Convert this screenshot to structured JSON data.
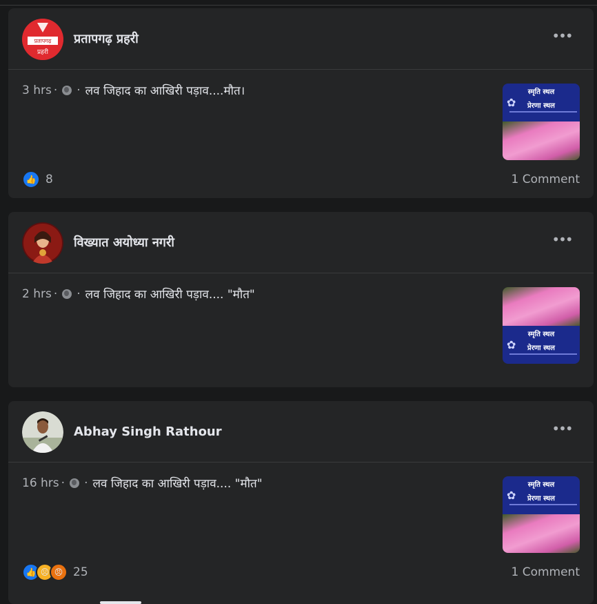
{
  "posts": [
    {
      "author": "प्रतापगढ़ प्रहरी",
      "avatar_text": "प्रतापगढ़",
      "avatar_sub": "प्रहरी",
      "time": "3 hrs",
      "text": "लव जिहाद का आखिरी पड़ाव....मौत।",
      "reaction_count": "8",
      "comments": "1 Comment"
    },
    {
      "author": "विख्यात अयोध्या नगरी",
      "time": "2 hrs",
      "text": "लव जिहाद का आखिरी पड़ाव.... \"मौत\""
    },
    {
      "author": "Abhay Singh Rathour",
      "time": "16 hrs",
      "text": "लव जिहाद का आखिरी पड़ाव.... \"मौत\"",
      "reaction_count": "25",
      "comments": "1 Comment"
    }
  ],
  "thumbnail": {
    "banner_line1": "स्मृति स्थल",
    "banner_line2": "प्रेरणा स्थल"
  },
  "icons": {
    "more": "more-horizontal-icon",
    "globe": "globe-icon",
    "like": "like-reaction-icon",
    "sad": "sad-reaction-icon",
    "angry": "angry-reaction-icon"
  },
  "colors": {
    "background": "#18191a",
    "card": "#242526",
    "like_blue": "#1877f2"
  }
}
